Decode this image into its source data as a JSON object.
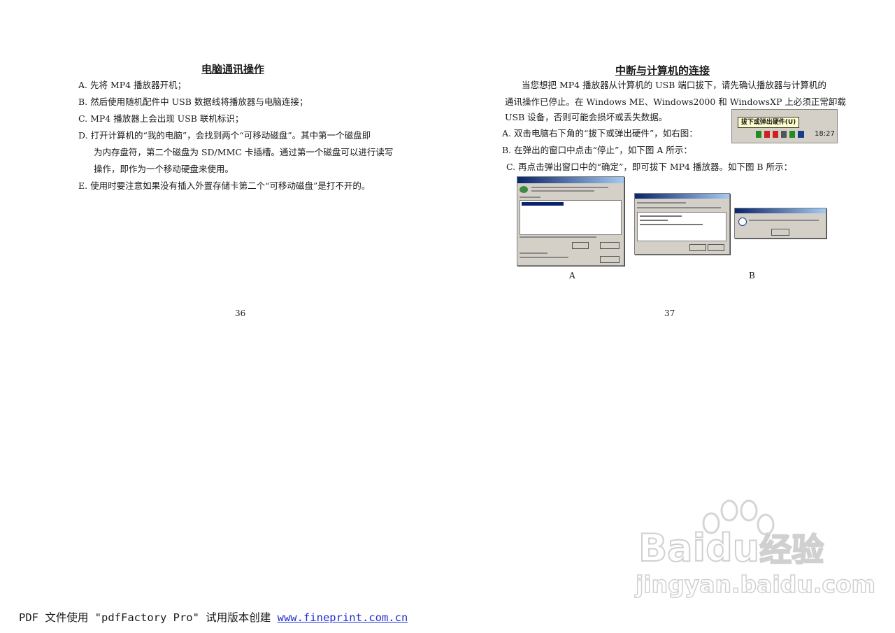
{
  "left_page": {
    "title": "电脑通讯操作",
    "items": [
      "A.  先将 MP4 播放器开机；",
      "B.  然后使用随机配件中 USB 数据线将播放器与电脑连接；",
      "C.  MP4 播放器上会出现 USB 联机标识；",
      "D.  打开计算机的“我的电脑”，会找到两个“可移动磁盘”。其中第一个磁盘即",
      "为内存盘符，第二个磁盘为 SD/MMC 卡插槽。通过第一个磁盘可以进行读写",
      "操作，即作为一个移动硬盘来使用。",
      "E.  使用时要注意如果没有插入外置存储卡第二个“可移动磁盘”是打不开的。"
    ],
    "page_number": "36"
  },
  "right_page": {
    "title": "中断与计算机的连接",
    "lines": [
      "当您想把 MP4 播放器从计算机的 USB 端口拔下，请先确认播放器与计算机的",
      "通讯操作已停止。在 Windows ME、Windows2000 和 WindowsXP 上必须正常卸载",
      "USB 设备，否则可能会损坏或丢失数据。",
      "A. 双击电脑右下角的“拔下或弹出硬件”，如右图：",
      "B. 在弹出的窗口中点击“停止”，如下图 A 所示：",
      "C. 再点击弹出窗口中的“确定”，即可拔下 MP4 播放器。如下图 B 所示："
    ],
    "tray_menu_label": "拔下或弹出硬件(U)",
    "tray_time": "18:27",
    "caption_a": "A",
    "caption_b": "B",
    "page_number": "37"
  },
  "watermark": {
    "brand": "Bai",
    "brand_du": "du",
    "brand_cn": "经验",
    "url": "jingyan.baidu.com"
  },
  "footer": {
    "prefix": "PDF 文件使用 \"pdfFactory Pro\" 试用版本创建 ",
    "link": "www.fineprint.com.cn"
  }
}
